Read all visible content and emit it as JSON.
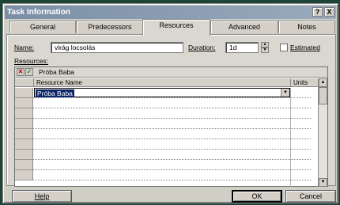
{
  "window": {
    "title": "Task Information",
    "help_button": "?",
    "close_button": "X"
  },
  "tabs": [
    {
      "label": "General",
      "active": false
    },
    {
      "label": "Predecessors",
      "active": false
    },
    {
      "label": "Resources",
      "active": true
    },
    {
      "label": "Advanced",
      "active": false
    },
    {
      "label": "Notes",
      "active": false
    }
  ],
  "form": {
    "name_label": "Name:",
    "name_value": "virág locsolás",
    "duration_label": "Duration:",
    "duration_value": "1d",
    "estimated_label": "Estimated",
    "estimated_checked": false,
    "resources_label": "Resources:"
  },
  "grid": {
    "cancel_glyph": "✕",
    "accept_glyph": "✓",
    "edit_bar_value": "Próba Baba",
    "columns": [
      "Resource Name",
      "Units"
    ],
    "rows": [
      {
        "resource_name": "Próba Baba",
        "units": ""
      }
    ]
  },
  "buttons": {
    "help": "Help",
    "ok": "OK",
    "cancel": "Cancel"
  },
  "colors": {
    "selection": "#0a246a",
    "title_bar": "#7a8fa6",
    "dialog_face": "#d9d7cf"
  }
}
